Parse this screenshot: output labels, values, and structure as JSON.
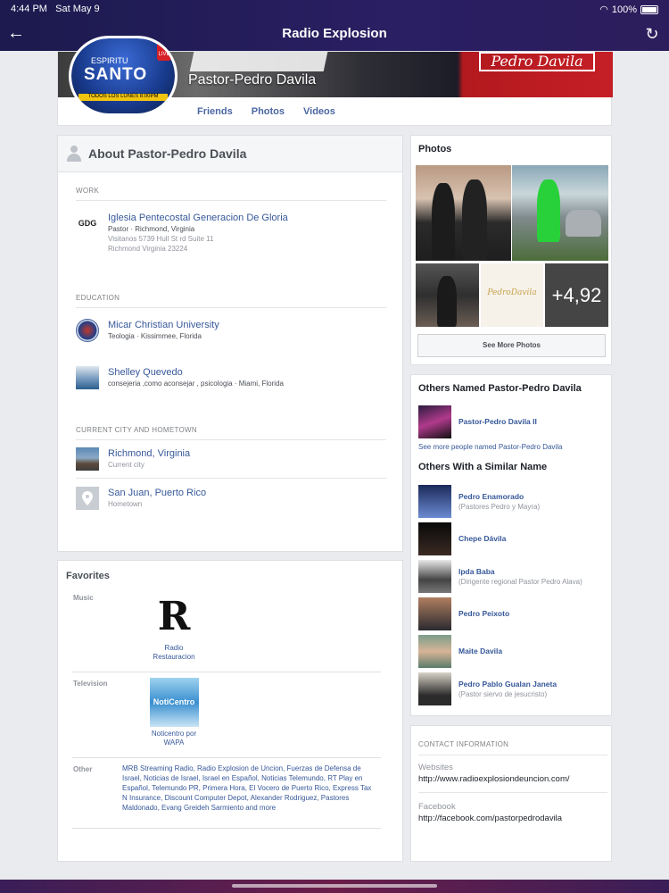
{
  "status": {
    "time": "4:44 PM",
    "date": "Sat May 9",
    "battery": "100%"
  },
  "nav": {
    "title": "Radio Explosion",
    "back_icon": "arrow-left-icon",
    "refresh_icon": "refresh-icon"
  },
  "profile": {
    "name": "Pastor-Pedro Davila",
    "tabs": [
      "Friends",
      "Photos",
      "Videos"
    ],
    "cover_script": "Pedro Davila",
    "pic_text": {
      "top": "ESPIRITU",
      "main": "SANTO",
      "band": "TODOS LOS LUNES 8:00PM",
      "live": "LIVE"
    }
  },
  "about": {
    "title": "About Pastor-Pedro Davila",
    "work": {
      "label": "WORK",
      "name": "Iglesia Pentecostal Generacion De Gloria",
      "logo_text": "GDG",
      "role": "Pastor · Richmond, Virginia",
      "address1": "Visitanos 5739 Hull St rd Suite 11",
      "address2": "Richmond Virginia 23224"
    },
    "education": {
      "label": "EDUCATION",
      "items": [
        {
          "name": "Micar Christian University",
          "sub": "Teologia · Kissimmee, Florida"
        },
        {
          "name": "Shelley Quevedo",
          "sub": "consejeria ,como aconsejar , psicologia · Miami, Florida"
        }
      ]
    },
    "places": {
      "label": "CURRENT CITY AND HOMETOWN",
      "items": [
        {
          "name": "Richmond, Virginia",
          "sub": "Current city"
        },
        {
          "name": "San Juan, Puerto Rico",
          "sub": "Hometown"
        }
      ]
    }
  },
  "favorites": {
    "title": "Favorites",
    "music": {
      "label": "Music",
      "name": "Radio Restauracion",
      "logo_letter": "R"
    },
    "television": {
      "label": "Television",
      "name": "Noticentro por WAPA",
      "logo_text": "NotiCentro"
    },
    "other": {
      "label": "Other",
      "text": "MRB Streaming Radio, Radio Explosion de Uncion, Fuerzas de Defensa de Israel, Noticias de Israel, Israel en Español, Noticias Telemundo, RT Play en Español, Telemundo PR, Primera Hora, El Vocero de Puerto Rico, Express Tax N Insurance, Discount Computer Depot, Alexander Rodriguez, Pastores Maldonado, Evang Greideh Sarmiento and more"
    }
  },
  "photos": {
    "title": "Photos",
    "more_count": "+4,92",
    "tile_text": "PedroDavila",
    "button": "See More Photos"
  },
  "others": {
    "title1": "Others Named Pastor-Pedro Davila",
    "named": [
      {
        "name": "Pastor-Pedro Davila II"
      }
    ],
    "see_more": "See more people named Pastor-Pedro Davila",
    "title2": "Others With a Similar Name",
    "similar": [
      {
        "name": "Pedro Enamorado",
        "sub": "(Pastores Pedro y Mayra)"
      },
      {
        "name": "Chepe Dávila",
        "sub": ""
      },
      {
        "name": "Ipda Baba",
        "sub": "(Dirigente regional Pastor Pedro Alava)"
      },
      {
        "name": "Pedro Peixoto",
        "sub": ""
      },
      {
        "name": "Maite Davila",
        "sub": ""
      },
      {
        "name": "Pedro Pablo Gualan Janeta",
        "sub": "(Pastor siervo de jesucristo)"
      }
    ]
  },
  "contact": {
    "label": "CONTACT INFORMATION",
    "websites_label": "Websites",
    "website": "http://www.radioexplosiondeuncion.com/",
    "facebook_label": "Facebook",
    "facebook": "http://facebook.com/pastorpedrodavila"
  }
}
